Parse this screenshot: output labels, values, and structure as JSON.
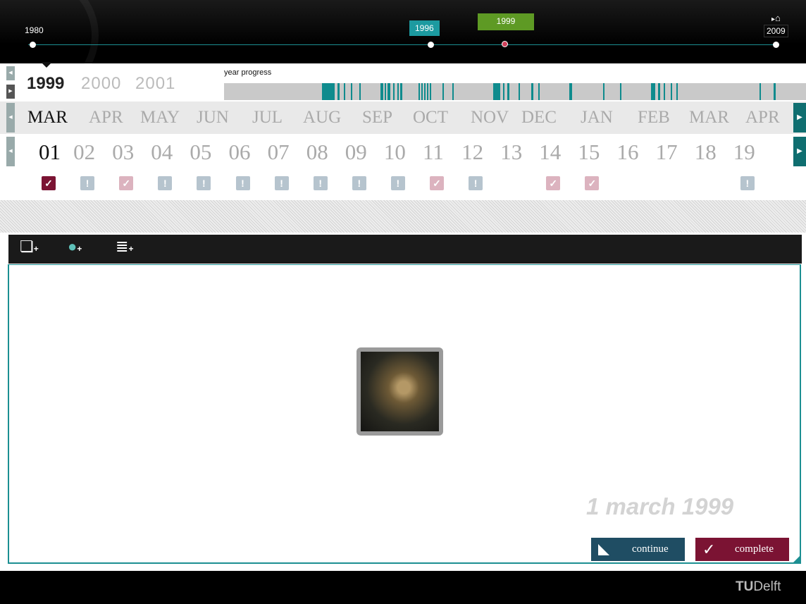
{
  "timeline": {
    "start_label": "1980",
    "end_label": "2009",
    "marker_1996": "1996",
    "marker_1999": "1999",
    "home_icon": "home-icon"
  },
  "year_nav": {
    "selected": "1999",
    "others": [
      "2000",
      "2001"
    ],
    "progress_label": "year progress"
  },
  "months": [
    "MAR",
    "APR",
    "MAY",
    "JUN",
    "JUL",
    "AUG",
    "SEP",
    "OCT",
    "NOV",
    "DEC",
    "JAN",
    "FEB",
    "MAR",
    "APR"
  ],
  "days": [
    "01",
    "02",
    "03",
    "04",
    "05",
    "06",
    "07",
    "08",
    "09",
    "10",
    "11",
    "12",
    "13",
    "14",
    "15",
    "16",
    "17",
    "18",
    "19"
  ],
  "day_status": [
    "done-active",
    "warn",
    "done",
    "warn",
    "warn",
    "warn",
    "warn",
    "warn",
    "warn",
    "warn",
    "done",
    "warn",
    "",
    "done",
    "done",
    "",
    "",
    "",
    "warn"
  ],
  "toolbar": {
    "icons": [
      "add-photo-icon",
      "add-location-icon",
      "add-text-icon"
    ]
  },
  "panel": {
    "date_label": "1 march 1999",
    "continue_label": "continue",
    "complete_label": "complete"
  },
  "footer": {
    "logo_text": "TUDelft"
  },
  "colors": {
    "accent": "#1c8f92",
    "warn": "#b6c4ce",
    "done": "#dcb3bf",
    "active": "#7b1333"
  }
}
